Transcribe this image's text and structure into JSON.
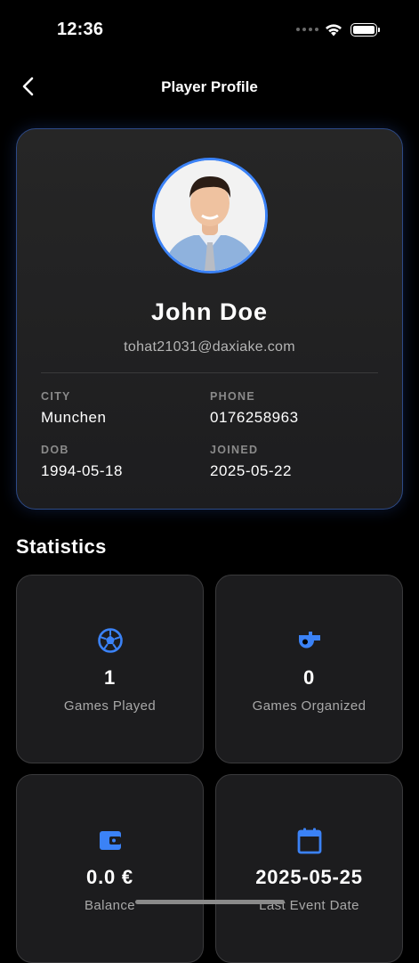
{
  "status_bar": {
    "time": "12:36"
  },
  "nav": {
    "title": "Player Profile",
    "back_icon": "chevron-left-icon"
  },
  "profile": {
    "name": "John Doe",
    "email": "tohat21031@daxiake.com",
    "fields": [
      {
        "label": "CITY",
        "value": "Munchen"
      },
      {
        "label": "PHONE",
        "value": "0176258963"
      },
      {
        "label": "DOB",
        "value": "1994-05-18"
      },
      {
        "label": "JOINED",
        "value": "2025-05-22"
      }
    ]
  },
  "statistics": {
    "title": "Statistics",
    "cards": [
      {
        "icon": "soccer-ball-icon",
        "value": "1",
        "label": "Games Played"
      },
      {
        "icon": "whistle-icon",
        "value": "0",
        "label": "Games Organized"
      },
      {
        "icon": "wallet-icon",
        "value": "0.0 €",
        "label": "Balance"
      },
      {
        "icon": "calendar-icon",
        "value": "2025-05-25",
        "label": "Last Event Date"
      }
    ]
  },
  "colors": {
    "accent": "#3b82f6",
    "background": "#000000",
    "card": "#1c1c1e"
  }
}
